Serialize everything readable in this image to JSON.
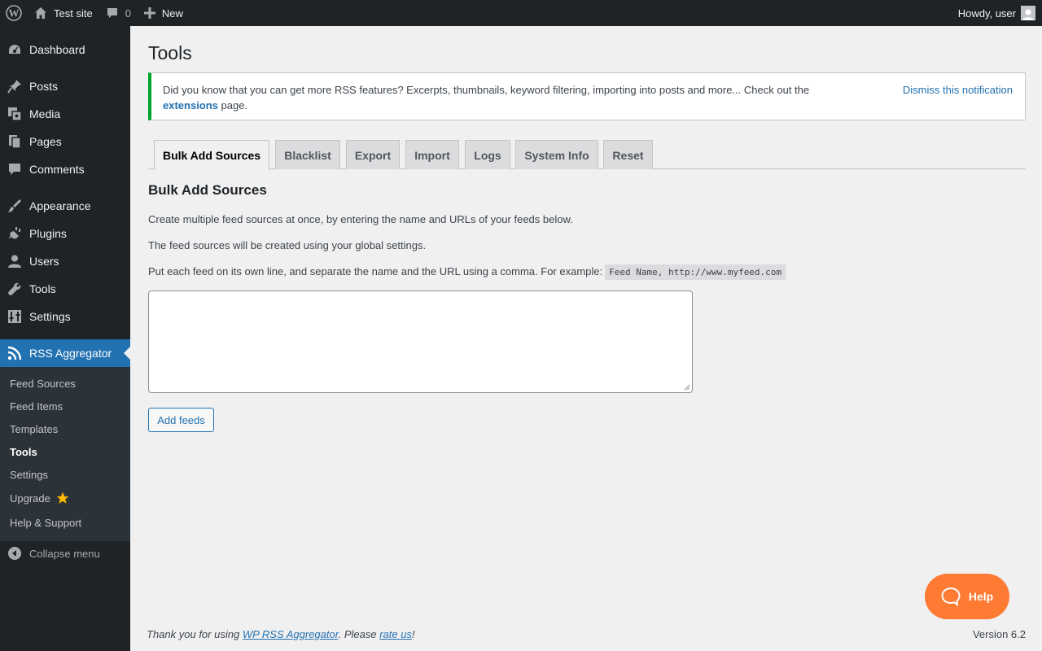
{
  "adminbar": {
    "site_name": "Test site",
    "comments_count": "0",
    "new_label": "New",
    "howdy": "Howdy, user"
  },
  "sidebar": {
    "items": [
      {
        "label": "Dashboard",
        "icon": "dashboard-icon"
      },
      {
        "label": "Posts",
        "icon": "pin-icon"
      },
      {
        "label": "Media",
        "icon": "media-icon"
      },
      {
        "label": "Pages",
        "icon": "pages-icon"
      },
      {
        "label": "Comments",
        "icon": "comment-icon"
      },
      {
        "label": "Appearance",
        "icon": "brush-icon"
      },
      {
        "label": "Plugins",
        "icon": "plugin-icon"
      },
      {
        "label": "Users",
        "icon": "user-icon"
      },
      {
        "label": "Tools",
        "icon": "wrench-icon"
      },
      {
        "label": "Settings",
        "icon": "settings-icon"
      },
      {
        "label": "RSS Aggregator",
        "icon": "rss-icon"
      }
    ],
    "submenu": [
      {
        "label": "Feed Sources"
      },
      {
        "label": "Feed Items"
      },
      {
        "label": "Templates"
      },
      {
        "label": "Tools"
      },
      {
        "label": "Settings"
      },
      {
        "label": "Upgrade"
      },
      {
        "label": "Help & Support"
      }
    ],
    "collapse_label": "Collapse menu"
  },
  "main": {
    "title": "Tools",
    "notice": {
      "text_before": "Did you know that you can get more RSS features? Excerpts, thumbnails, keyword filtering, importing into posts and more... Check out the",
      "link": "extensions",
      "text_after": "page.",
      "dismiss": "Dismiss this notification"
    },
    "tabs": [
      {
        "label": "Bulk Add Sources"
      },
      {
        "label": "Blacklist"
      },
      {
        "label": "Export"
      },
      {
        "label": "Import"
      },
      {
        "label": "Logs"
      },
      {
        "label": "System Info"
      },
      {
        "label": "Reset"
      }
    ],
    "section_title": "Bulk Add Sources",
    "para1": "Create multiple feed sources at once, by entering the name and URLs of your feeds below.",
    "para2": "The feed sources will be created using your global settings.",
    "para3": "Put each feed on its own line, and separate the name and the URL using a comma. For example:",
    "example_code": "Feed Name, http://www.myfeed.com",
    "textarea_value": "",
    "add_button": "Add feeds",
    "help_button": "Help"
  },
  "footer": {
    "thanks_before": "Thank you for using",
    "plugin_link": "WP RSS Aggregator",
    "please": ". Please",
    "rate_link": "rate us",
    "excl": "!",
    "version": "Version 6.2"
  },
  "colors": {
    "admin_bg": "#1d2327",
    "accent": "#2271b1",
    "notice_border": "#00a32a",
    "help_orange": "#ff7a33"
  }
}
